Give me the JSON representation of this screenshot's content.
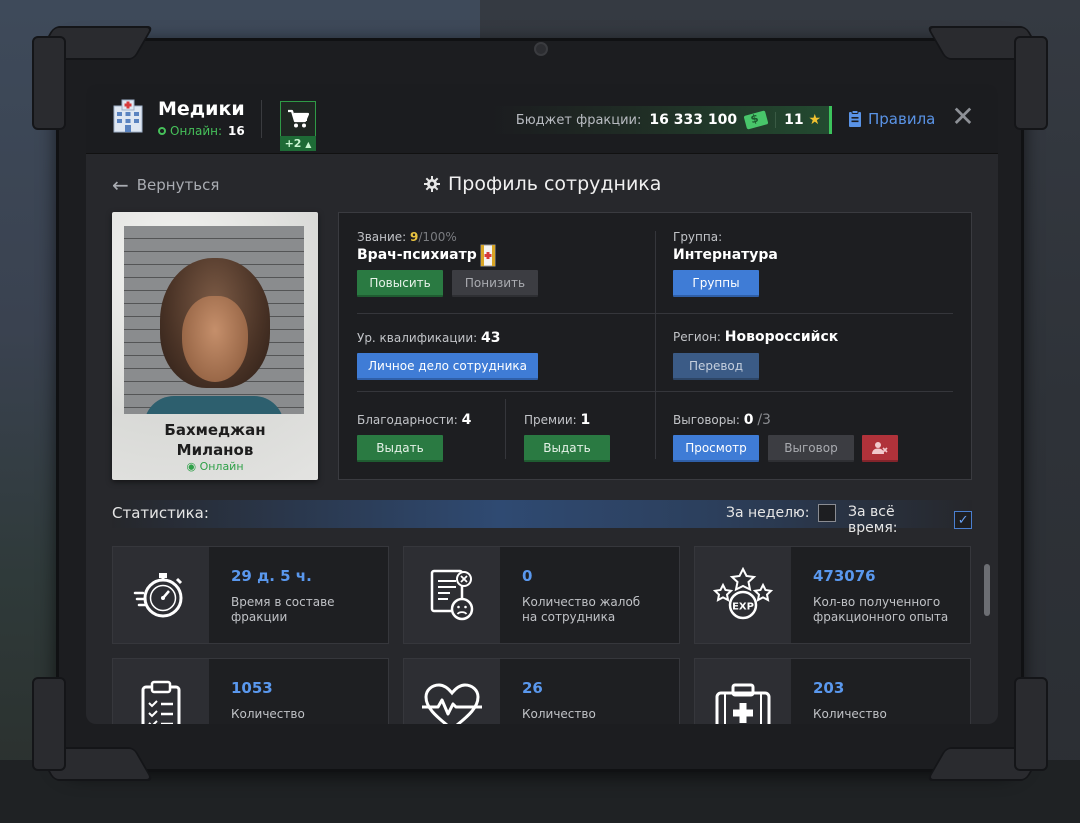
{
  "header": {
    "faction_name": "Медики",
    "online_label": "Онлайн:",
    "online_count": "16",
    "cart_badge": "+2",
    "budget_label": "Бюджет фракции:",
    "budget_amount": "16 333 100",
    "stars_count": "11",
    "rules_label": "Правила",
    "close_symbol": "✕"
  },
  "nav": {
    "back_label": "Вернуться",
    "page_title": "Профиль сотрудника"
  },
  "profile": {
    "name_line1": "Бахмеджан",
    "name_line2": "Миланов",
    "status": "Онлайн"
  },
  "rank": {
    "label": "Звание:",
    "level": "9",
    "progress": "/100%",
    "title": "Врач-психиатр",
    "promote_label": "Повысить",
    "demote_label": "Понизить"
  },
  "group": {
    "label": "Группа:",
    "value": "Интернатура",
    "button_label": "Группы"
  },
  "qualification": {
    "label": "Ур. квалификации:",
    "value": "43",
    "button_label": "Личное дело сотрудника"
  },
  "region": {
    "label": "Регион:",
    "value": "Новороссийск",
    "button_label": "Перевод"
  },
  "thanks": {
    "label": "Благодарности:",
    "value": "4",
    "button_label": "Выдать"
  },
  "bonuses": {
    "label": "Премии:",
    "value": "1",
    "button_label": "Выдать"
  },
  "reprimands": {
    "label": "Выговоры:",
    "value": "0",
    "max": "/3",
    "view_label": "Просмотр",
    "reprimand_label": "Выговор"
  },
  "stats": {
    "title": "Статистика:",
    "week_label": "За неделю:",
    "all_time_label": "За всё время:",
    "all_time_checkmark": "✓",
    "cards": [
      {
        "value": "29 д. 5 ч.",
        "desc1": "Время в составе",
        "desc2": "фракции",
        "icon": "stopwatch-icon"
      },
      {
        "value": "0",
        "desc1": "Количество жалоб",
        "desc2": "на сотрудника",
        "icon": "complaint-doc-icon"
      },
      {
        "value": "473076",
        "desc1": "Кол-во полученного",
        "desc2": "фракционного опыта",
        "icon": "exp-stars-icon"
      },
      {
        "value": "1053",
        "desc1": "Количество",
        "desc2": "",
        "icon": "clipboard-icon"
      },
      {
        "value": "26",
        "desc1": "Количество",
        "desc2": "",
        "icon": "heart-pulse-icon"
      },
      {
        "value": "203",
        "desc1": "Количество",
        "desc2": "",
        "icon": "medkit-icon"
      }
    ]
  },
  "colors": {
    "accent_blue": "#3f7cd6",
    "accent_green": "#2a7a42",
    "online_green": "#46c05a",
    "rank_yellow": "#e8c340",
    "danger_red": "#b0323a"
  }
}
